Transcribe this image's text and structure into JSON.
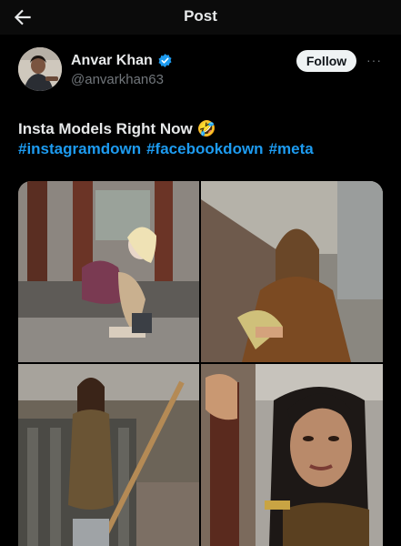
{
  "header": {
    "title": "Post",
    "back_icon": "arrow-left-icon"
  },
  "author": {
    "name": "Anvar Khan",
    "handle": "@anvarkhan63",
    "verified_icon": "verified-badge-icon"
  },
  "actions": {
    "follow_label": "Follow",
    "more_label": "···"
  },
  "post": {
    "text": "Insta Models Right Now 🤣",
    "hashtags": [
      "#instagramdown",
      "#facebookdown",
      "#meta"
    ]
  },
  "colors": {
    "background": "#000000",
    "link": "#1d9bf0",
    "verified": "#1d9bf0",
    "follow_bg": "#eff3f4"
  },
  "media": {
    "count": 4,
    "layout": "2x2 grid"
  }
}
